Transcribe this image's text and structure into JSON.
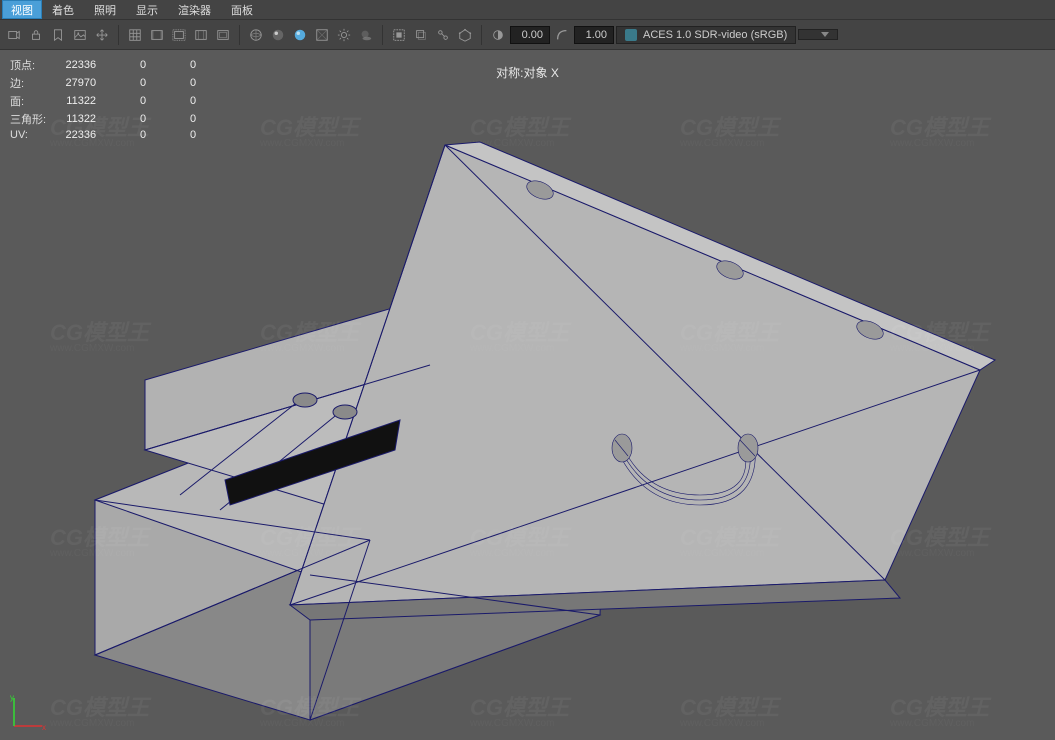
{
  "menubar": {
    "view_tab": "视图",
    "items": [
      "着色",
      "照明",
      "显示",
      "渲染器",
      "面板"
    ]
  },
  "toolbar": {
    "num1": "0.00",
    "num2": "1.00",
    "colorspace": "ACES 1.0 SDR-video (sRGB)"
  },
  "hud": {
    "rows": [
      {
        "label": "顶点:",
        "a": "22336",
        "b": "0",
        "c": "0"
      },
      {
        "label": "边:",
        "a": "27970",
        "b": "0",
        "c": "0"
      },
      {
        "label": "面:",
        "a": "11322",
        "b": "0",
        "c": "0"
      },
      {
        "label": "三角形:",
        "a": "11322",
        "b": "0",
        "c": "0"
      },
      {
        "label": "UV:",
        "a": "22336",
        "b": "0",
        "c": "0"
      }
    ]
  },
  "status": {
    "axis_label": "对称:对象 X"
  },
  "watermark": {
    "brand": "CG模型王",
    "url": "www.CGMXW.com"
  },
  "gizmo": {
    "x": "x",
    "y": "y"
  }
}
